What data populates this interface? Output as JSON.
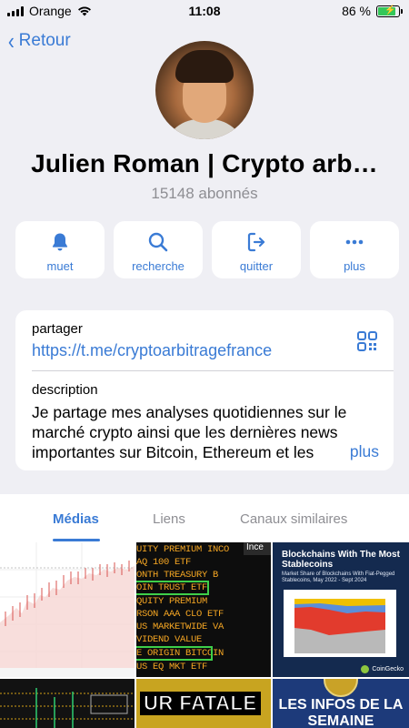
{
  "status_bar": {
    "carrier": "Orange",
    "time": "11:08",
    "battery": "86 %",
    "battery_level": 0.86
  },
  "nav": {
    "back_label": "Retour"
  },
  "channel": {
    "name": "Julien Roman | Crypto arb…",
    "subscribers": "15148 abonnés"
  },
  "actions": [
    {
      "icon": "bell-icon",
      "label": "muet"
    },
    {
      "icon": "search-icon",
      "label": "recherche"
    },
    {
      "icon": "leave-icon",
      "label": "quitter"
    },
    {
      "icon": "more-icon",
      "label": "plus"
    }
  ],
  "info": {
    "share_label": "partager",
    "share_link": "https://t.me/cryptoarbitragefrance",
    "description_label": "description",
    "description": "Je partage mes analyses quotidiennes sur le marché crypto ainsi que les dernières news importantes sur Bitcoin, Ethereum et les",
    "more_label": "plus"
  },
  "tabs": [
    {
      "label": "Médias",
      "active": true
    },
    {
      "label": "Liens",
      "active": false
    },
    {
      "label": "Canaux similaires",
      "active": false
    }
  ],
  "media": {
    "etf_header": "Ince",
    "etf_rows": [
      "UITY PREMIUM INCO",
      "AQ 100 ETF",
      "ONTH TREASURY B",
      "OIN TRUST ETF",
      "QUITY PREMIUM",
      "RSON AAA CLO ETF",
      "US MARKETWIDE VA",
      "VIDEND VALUE",
      "E ORIGIN BITCOIN",
      "US EQ MKT ETF"
    ],
    "stablecoin_title": "Blockchains With The Most Stablecoins",
    "stablecoin_subtitle": "Market Share of Blockchains With Fiat-Pegged Stablecoins, May 2022 - Sept 2024",
    "stablecoin_brand": "CoinGecko",
    "thumb5_text": "UR FATALE",
    "thumb6_text": "LES INFOS DE LA SEMAINE"
  },
  "colors": {
    "accent": "#3a7bd5",
    "background": "#efeff4",
    "secondary_text": "#8e8e93"
  }
}
